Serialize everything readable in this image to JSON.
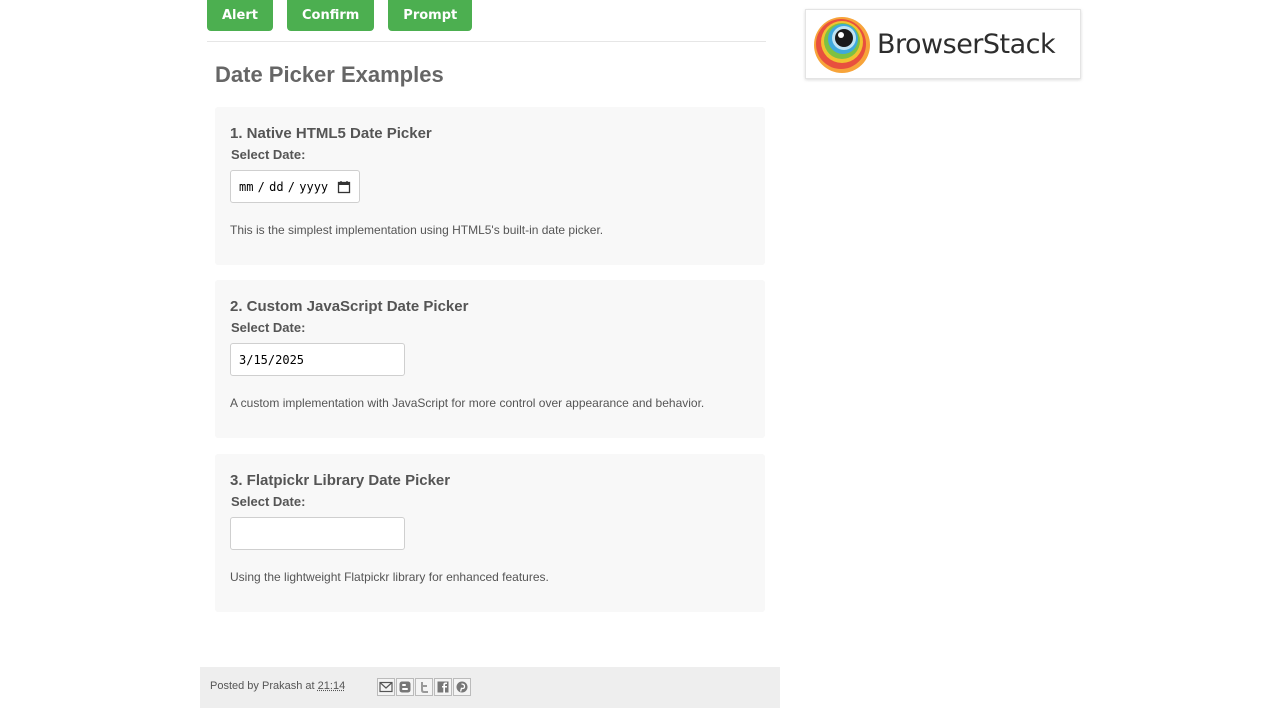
{
  "toolbar": {
    "alert_label": "Alert",
    "confirm_label": "Confirm",
    "prompt_label": "Prompt"
  },
  "page": {
    "title": "Date Picker Examples"
  },
  "sections": [
    {
      "heading": "1. Native HTML5 Date Picker",
      "label": "Select Date:",
      "value": "mm / dd / yyyy",
      "description": "This is the simplest implementation using HTML5's built-in date picker."
    },
    {
      "heading": "2. Custom JavaScript Date Picker",
      "label": "Select Date:",
      "value": "3/15/2025",
      "description": "A custom implementation with JavaScript for more control over appearance and behavior."
    },
    {
      "heading": "3. Flatpickr Library Date Picker",
      "label": "Select Date:",
      "value": "",
      "description": "Using the lightweight Flatpickr library for enhanced features."
    }
  ],
  "footer": {
    "posted_by_prefix": "Posted by",
    "author": "Prakash",
    "at": "at",
    "time": "21:14",
    "share_icons": [
      "email-icon",
      "blogger-icon",
      "twitter-icon",
      "facebook-icon",
      "pinterest-icon"
    ]
  },
  "sidebar": {
    "ad_brand": "BrowserStack"
  },
  "colors": {
    "accent": "#4caf50",
    "panel": "#f8f8f8",
    "footer": "#eeeeee"
  }
}
